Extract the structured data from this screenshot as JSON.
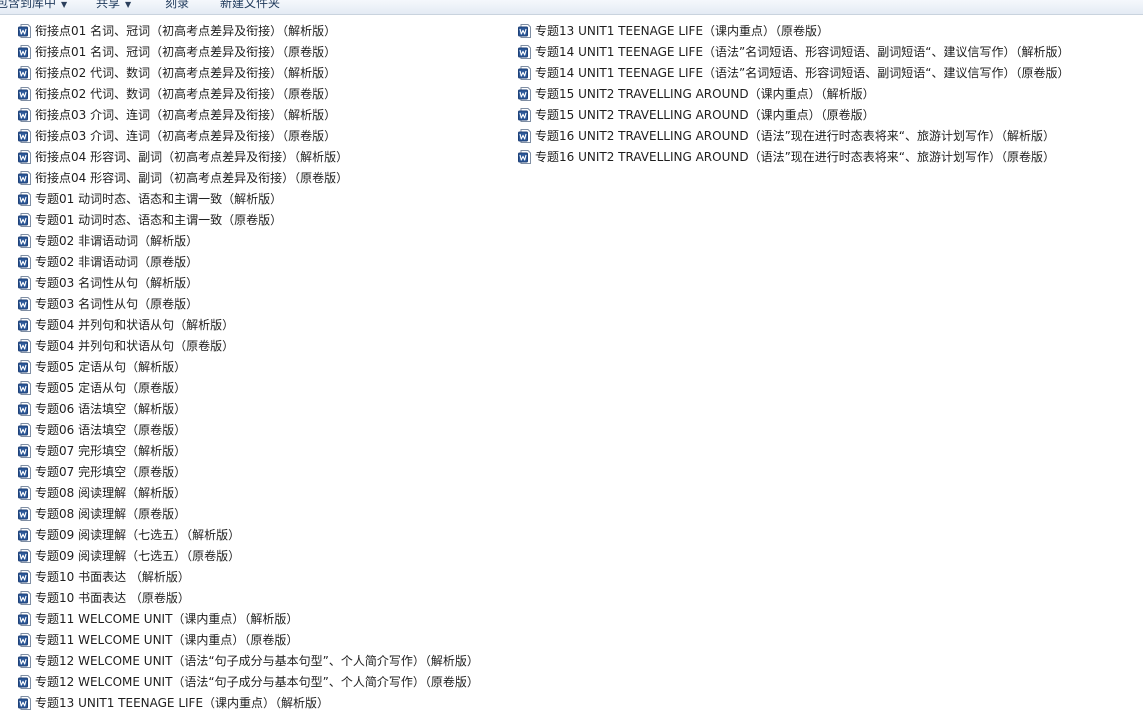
{
  "toolbar": {
    "items": [
      {
        "label": "包含到库中",
        "has_dropdown": true
      },
      {
        "label": "共享",
        "has_dropdown": true
      },
      {
        "label": "刻录",
        "has_dropdown": false
      },
      {
        "label": "新建文件夹",
        "has_dropdown": false
      }
    ]
  },
  "file_icon": "word-document-icon",
  "colors": {
    "word_icon_blue": "#2b5797",
    "toolbar_text": "#1e395b"
  },
  "files_column_1": [
    "衔接点01 名词、冠词（初高考点差异及衔接）（解析版）",
    "衔接点01 名词、冠词（初高考点差异及衔接）（原卷版）",
    "衔接点02 代词、数词（初高考点差异及衔接）（解析版）",
    "衔接点02 代词、数词（初高考点差异及衔接）（原卷版）",
    "衔接点03 介词、连词（初高考点差异及衔接）（解析版）",
    "衔接点03 介词、连词（初高考点差异及衔接）（原卷版）",
    "衔接点04 形容词、副词（初高考点差异及衔接）（解析版）",
    "衔接点04 形容词、副词（初高考点差异及衔接）（原卷版）",
    "专题01 动词时态、语态和主谓一致（解析版）",
    "专题01 动词时态、语态和主谓一致（原卷版）",
    "专题02 非谓语动词（解析版）",
    "专题02 非谓语动词（原卷版）",
    "专题03 名词性从句（解析版）",
    "专题03 名词性从句（原卷版）",
    "专题04 并列句和状语从句（解析版）",
    "专题04 并列句和状语从句（原卷版）",
    "专题05 定语从句（解析版）",
    "专题05 定语从句（原卷版）",
    "专题06 语法填空（解析版）",
    "专题06 语法填空（原卷版）",
    "专题07 完形填空（解析版）",
    "专题07 完形填空（原卷版）",
    "专题08 阅读理解（解析版）",
    "专题08 阅读理解（原卷版）",
    "专题09 阅读理解（七选五）（解析版）",
    "专题09 阅读理解（七选五）（原卷版）",
    "专题10 书面表达 （解析版）",
    "专题10 书面表达 （原卷版）",
    "专题11 WELCOME UNIT（课内重点）（解析版）",
    "专题11 WELCOME UNIT（课内重点）（原卷版）",
    "专题12 WELCOME UNIT（语法“句子成分与基本句型”、个人简介写作）（解析版）",
    "专题12 WELCOME UNIT（语法“句子成分与基本句型”、个人简介写作）（原卷版）",
    "专题13 UNIT1 TEENAGE LIFE（课内重点）（解析版）"
  ],
  "files_column_2": [
    "专题13 UNIT1 TEENAGE LIFE（课内重点）（原卷版）",
    "专题14 UNIT1 TEENAGE LIFE（语法”名词短语、形容词短语、副词短语“、建议信写作）（解析版）",
    "专题14 UNIT1 TEENAGE LIFE（语法”名词短语、形容词短语、副词短语“、建议信写作）（原卷版）",
    "专题15 UNIT2 TRAVELLING AROUND（课内重点）（解析版）",
    "专题15 UNIT2 TRAVELLING AROUND（课内重点）（原卷版）",
    "专题16 UNIT2 TRAVELLING AROUND（语法”现在进行时态表将来“、旅游计划写作）（解析版）",
    "专题16 UNIT2 TRAVELLING AROUND（语法”现在进行时态表将来“、旅游计划写作）（原卷版）"
  ]
}
